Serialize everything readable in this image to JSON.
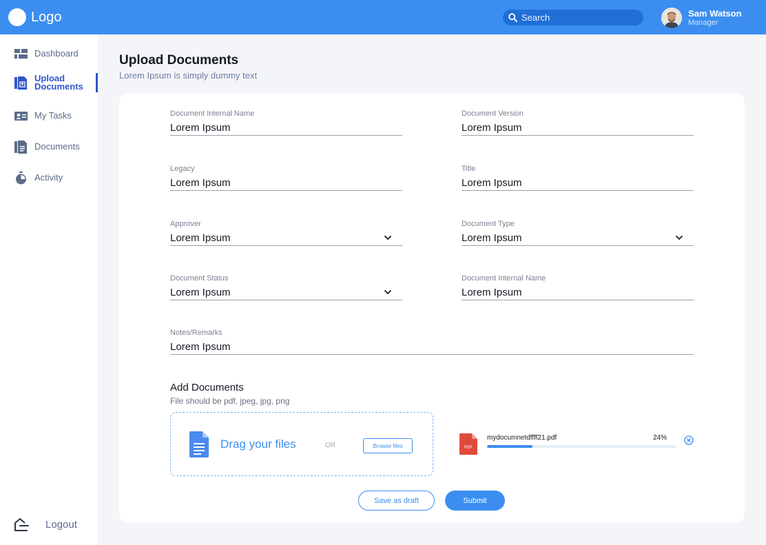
{
  "header": {
    "logo_text": "Logo",
    "search_placeholder": "Search",
    "user_name": "Sam Watson",
    "user_role": "Manager"
  },
  "sidebar": {
    "items": [
      {
        "label": "Dashboard",
        "icon": "dashboard-icon"
      },
      {
        "label": "Upload Documents",
        "icon": "upload-document-icon"
      },
      {
        "label": "My Tasks",
        "icon": "tasks-icon"
      },
      {
        "label": "Documents",
        "icon": "documents-icon"
      },
      {
        "label": "Activity",
        "icon": "timer-icon"
      }
    ],
    "logout_label": "Logout"
  },
  "page": {
    "title": "Upload Documents",
    "subtitle": "Lorem Ipsum is simply dummy text"
  },
  "form": {
    "fields": [
      {
        "label": "Document Internal Name",
        "value": "Lorem Ipsum"
      },
      {
        "label": "Document Version",
        "value": "Lorem Ipsum"
      },
      {
        "label": "Legacy",
        "value": "Lorem Ipsum"
      },
      {
        "label": "Title",
        "value": "Lorem Ipsum"
      },
      {
        "label": "Approver",
        "value": "Lorem Ipsum"
      },
      {
        "label": "Document Type",
        "value": "Lorem Ipsum"
      },
      {
        "label": "Document Status",
        "value": "Lorem Ipsum"
      },
      {
        "label": "Document Internal Name",
        "value": "Lorem Ipsum"
      }
    ],
    "notes": {
      "label": "Notes/Remarks",
      "value": "Lorem Ipsum"
    }
  },
  "upload": {
    "title": "Add Documents",
    "hint": "File should be pdf, jpeg, jpg, png",
    "drop_text": "Drag your files",
    "or_text": "OR",
    "browse_label": "Browse files",
    "file": {
      "name": "mydocumnetdffff21.pdf",
      "progress_text": "24%",
      "progress": 0.24,
      "type_badge": "PDF"
    }
  },
  "actions": {
    "draft_label": "Save as draft",
    "submit_label": "Submit"
  },
  "colors": {
    "accent": "#3b8ef0",
    "active_nav": "#2f56c8",
    "pdf_red": "#e04a3c"
  }
}
